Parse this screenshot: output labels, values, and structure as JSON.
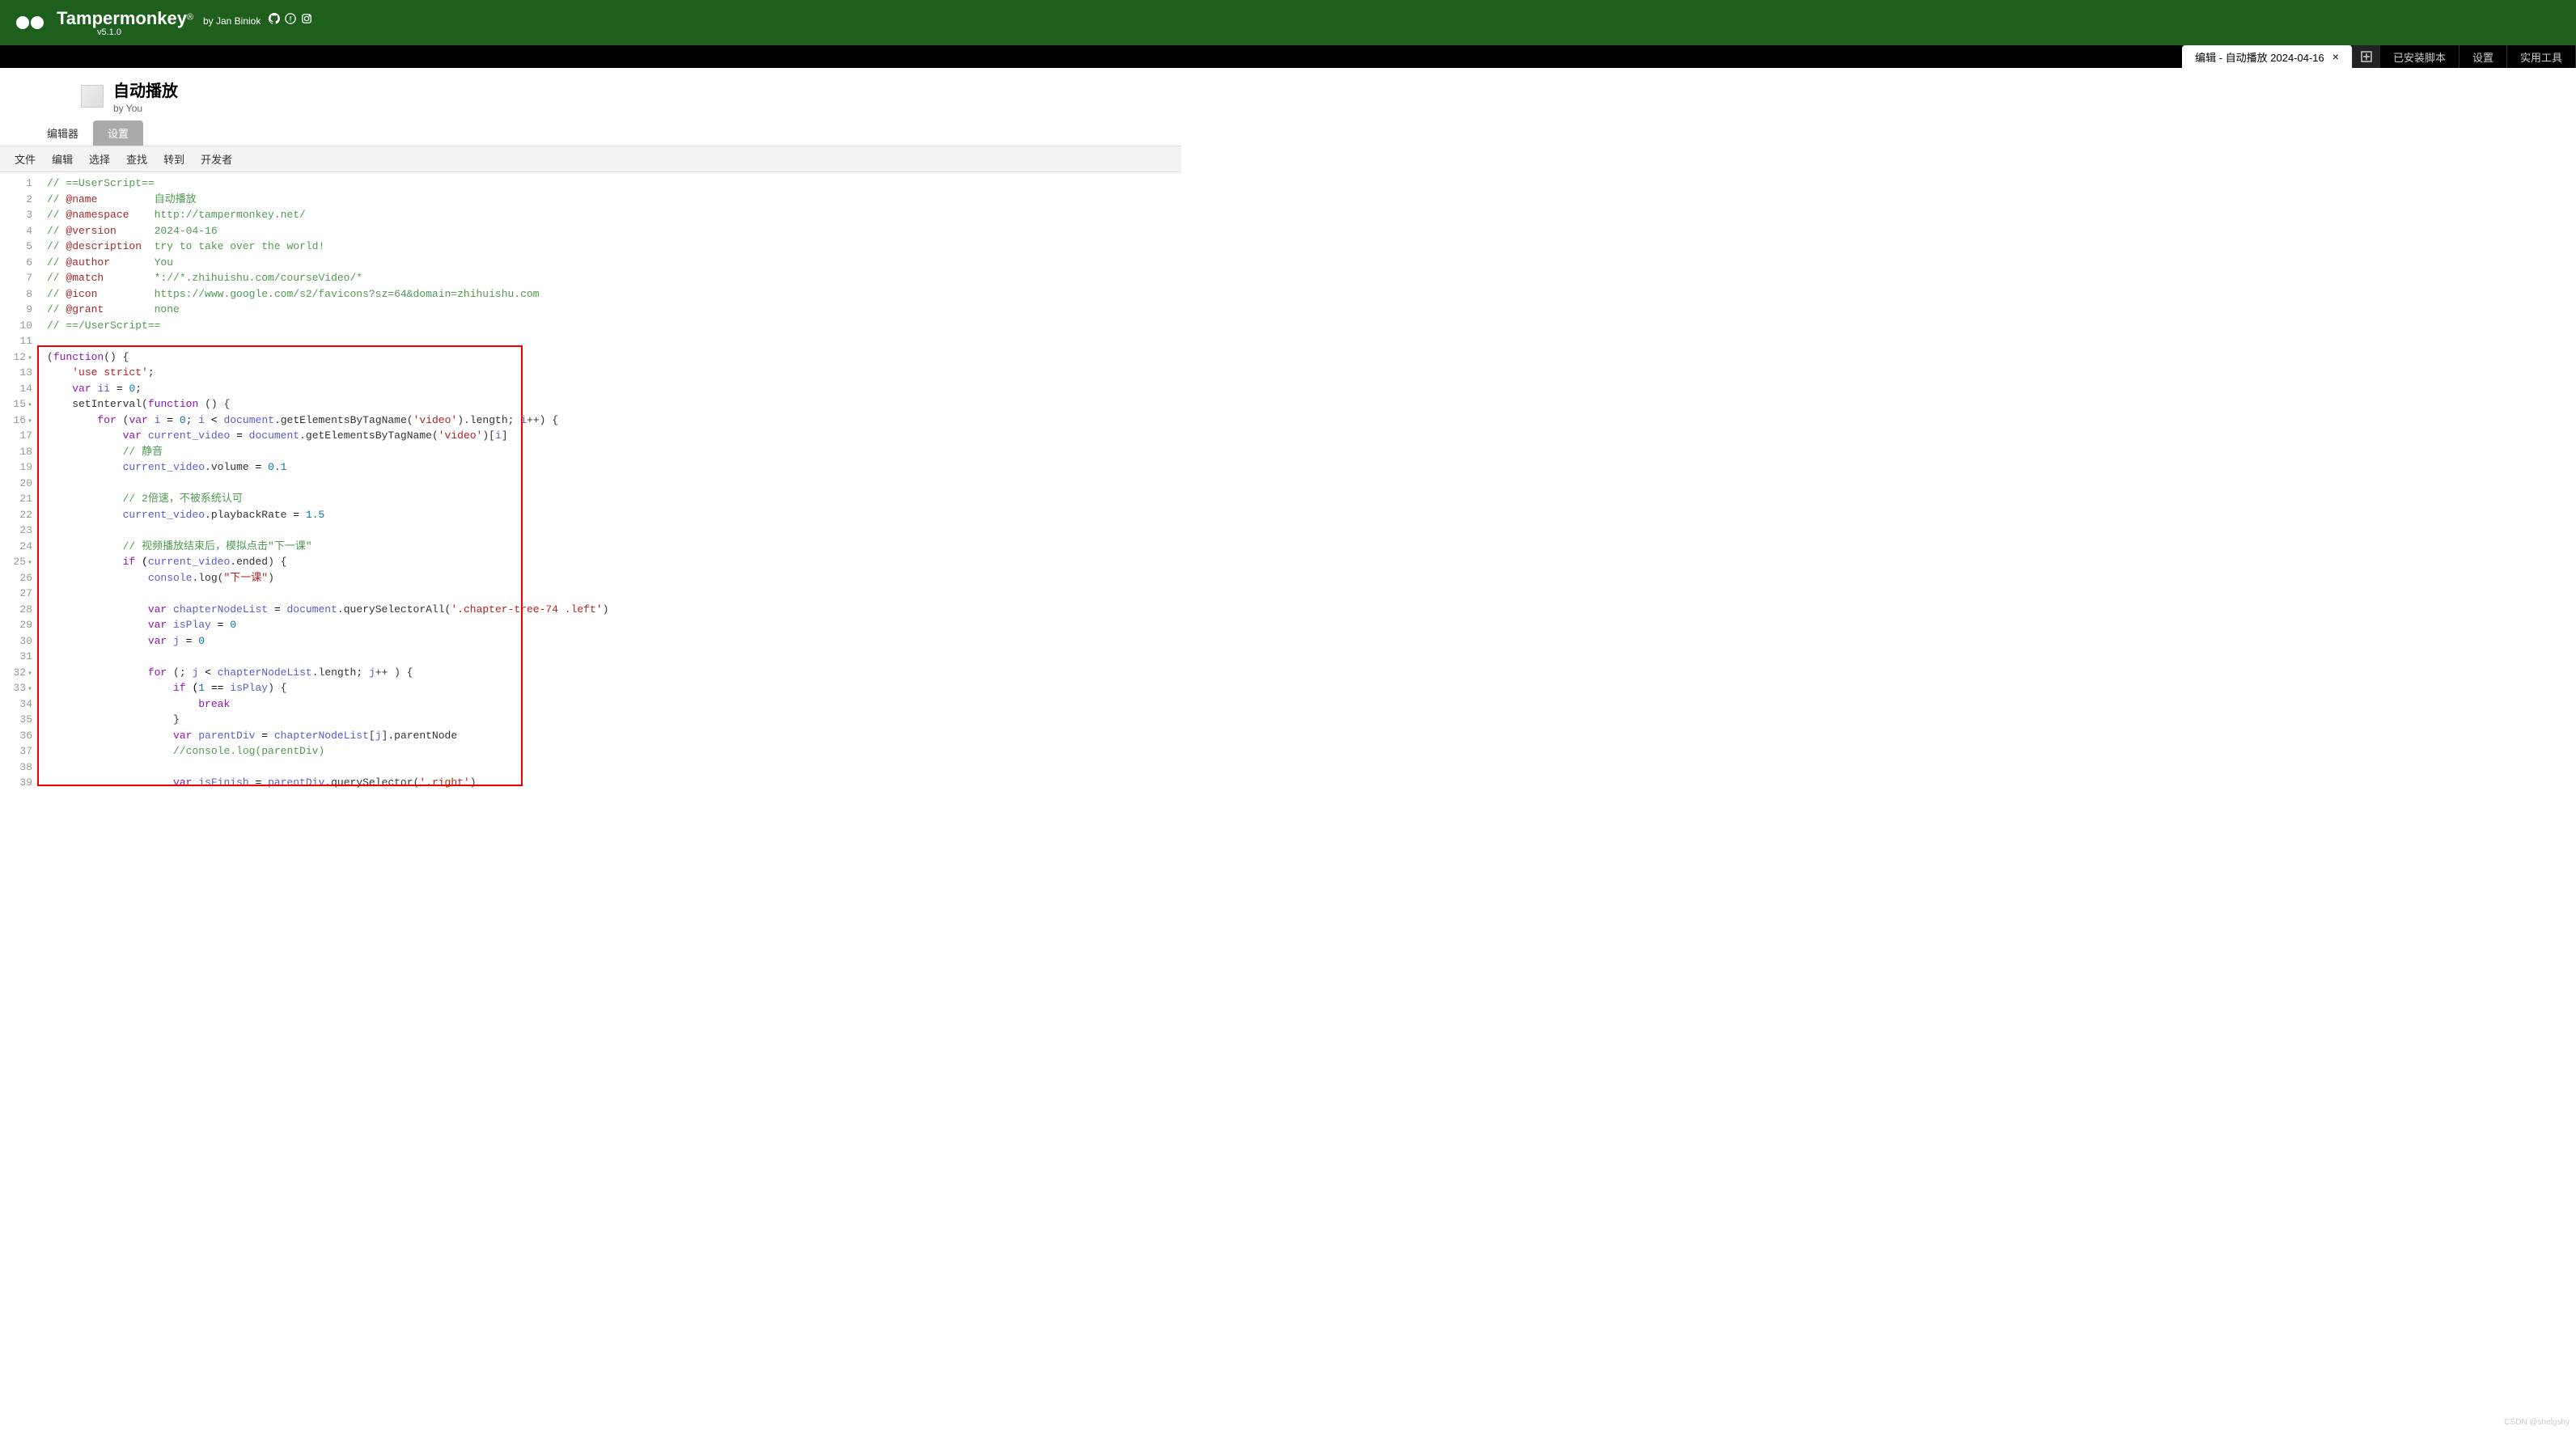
{
  "header": {
    "brand": "Tampermonkey",
    "reg": "®",
    "by": "by Jan Biniok",
    "version": "v5.1.0"
  },
  "tabs": {
    "active": "编辑 - 自动播放 2024-04-16",
    "installed": "已安装脚本",
    "settings": "设置",
    "utilities": "实用工具"
  },
  "script": {
    "title": "自动播放",
    "author": "by You"
  },
  "subtabs": {
    "editor": "编辑器",
    "settings": "设置"
  },
  "menu": {
    "file": "文件",
    "edit": "编辑",
    "select": "选择",
    "find": "查找",
    "goto": "转到",
    "dev": "开发者"
  },
  "code": {
    "lines": [
      {
        "n": "1",
        "t": [
          {
            "c": "c-comment",
            "v": "// ==UserScript=="
          }
        ]
      },
      {
        "n": "2",
        "t": [
          {
            "c": "c-comment",
            "v": "// "
          },
          {
            "c": "c-key",
            "v": "@name"
          },
          {
            "c": "c-comment",
            "v": "         自动播放"
          }
        ]
      },
      {
        "n": "3",
        "t": [
          {
            "c": "c-comment",
            "v": "// "
          },
          {
            "c": "c-key",
            "v": "@namespace"
          },
          {
            "c": "c-comment",
            "v": "    http://tampermonkey.net/"
          }
        ]
      },
      {
        "n": "4",
        "t": [
          {
            "c": "c-comment",
            "v": "// "
          },
          {
            "c": "c-key",
            "v": "@version"
          },
          {
            "c": "c-comment",
            "v": "      2024-04-16"
          }
        ]
      },
      {
        "n": "5",
        "t": [
          {
            "c": "c-comment",
            "v": "// "
          },
          {
            "c": "c-key",
            "v": "@description"
          },
          {
            "c": "c-comment",
            "v": "  try to take over the world!"
          }
        ]
      },
      {
        "n": "6",
        "t": [
          {
            "c": "c-comment",
            "v": "// "
          },
          {
            "c": "c-key",
            "v": "@author"
          },
          {
            "c": "c-comment",
            "v": "       You"
          }
        ]
      },
      {
        "n": "7",
        "t": [
          {
            "c": "c-comment",
            "v": "// "
          },
          {
            "c": "c-key",
            "v": "@match"
          },
          {
            "c": "c-comment",
            "v": "        *://*.zhihuishu.com/courseVideo/*"
          }
        ]
      },
      {
        "n": "8",
        "t": [
          {
            "c": "c-comment",
            "v": "// "
          },
          {
            "c": "c-key",
            "v": "@icon"
          },
          {
            "c": "c-comment",
            "v": "         https://www.google.com/s2/favicons?sz=64&domain=zhihuishu.com"
          }
        ]
      },
      {
        "n": "9",
        "t": [
          {
            "c": "c-comment",
            "v": "// "
          },
          {
            "c": "c-key",
            "v": "@grant"
          },
          {
            "c": "c-comment",
            "v": "        none"
          }
        ]
      },
      {
        "n": "10",
        "t": [
          {
            "c": "c-comment",
            "v": "// ==/UserScript=="
          }
        ]
      },
      {
        "n": "11",
        "t": []
      },
      {
        "n": "12",
        "f": true,
        "t": [
          {
            "c": "c-op",
            "v": "("
          },
          {
            "c": "c-keyword",
            "v": "function"
          },
          {
            "c": "c-op",
            "v": "() {"
          }
        ]
      },
      {
        "n": "13",
        "t": [
          {
            "c": "",
            "v": "    "
          },
          {
            "c": "c-string",
            "v": "'use strict'"
          },
          {
            "c": "c-op",
            "v": ";"
          }
        ]
      },
      {
        "n": "14",
        "t": [
          {
            "c": "",
            "v": "    "
          },
          {
            "c": "c-keyword",
            "v": "var"
          },
          {
            "c": "",
            "v": " "
          },
          {
            "c": "c-var",
            "v": "ii"
          },
          {
            "c": "",
            "v": " = "
          },
          {
            "c": "c-num",
            "v": "0"
          },
          {
            "c": "c-op",
            "v": ";"
          }
        ]
      },
      {
        "n": "15",
        "f": true,
        "t": [
          {
            "c": "",
            "v": "    "
          },
          {
            "c": "c-func",
            "v": "setInterval"
          },
          {
            "c": "c-op",
            "v": "("
          },
          {
            "c": "c-keyword",
            "v": "function"
          },
          {
            "c": "c-op",
            "v": " () {"
          }
        ]
      },
      {
        "n": "16",
        "f": true,
        "t": [
          {
            "c": "",
            "v": "        "
          },
          {
            "c": "c-keyword",
            "v": "for"
          },
          {
            "c": "c-op",
            "v": " ("
          },
          {
            "c": "c-keyword",
            "v": "var"
          },
          {
            "c": "",
            "v": " "
          },
          {
            "c": "c-var",
            "v": "i"
          },
          {
            "c": "",
            "v": " = "
          },
          {
            "c": "c-num",
            "v": "0"
          },
          {
            "c": "c-op",
            "v": "; "
          },
          {
            "c": "c-var",
            "v": "i"
          },
          {
            "c": "",
            "v": " < "
          },
          {
            "c": "c-var",
            "v": "document"
          },
          {
            "c": "c-op",
            "v": "."
          },
          {
            "c": "c-func",
            "v": "getElementsByTagName"
          },
          {
            "c": "c-op",
            "v": "("
          },
          {
            "c": "c-string",
            "v": "'video'"
          },
          {
            "c": "c-op",
            "v": ")."
          },
          {
            "c": "c-prop",
            "v": "length"
          },
          {
            "c": "c-op",
            "v": "; "
          },
          {
            "c": "c-var",
            "v": "i"
          },
          {
            "c": "c-op",
            "v": "++) {"
          }
        ]
      },
      {
        "n": "17",
        "t": [
          {
            "c": "",
            "v": "            "
          },
          {
            "c": "c-keyword",
            "v": "var"
          },
          {
            "c": "",
            "v": " "
          },
          {
            "c": "c-var",
            "v": "current_video"
          },
          {
            "c": "",
            "v": " = "
          },
          {
            "c": "c-var",
            "v": "document"
          },
          {
            "c": "c-op",
            "v": "."
          },
          {
            "c": "c-func",
            "v": "getElementsByTagName"
          },
          {
            "c": "c-op",
            "v": "("
          },
          {
            "c": "c-string",
            "v": "'video'"
          },
          {
            "c": "c-op",
            "v": ")["
          },
          {
            "c": "c-var",
            "v": "i"
          },
          {
            "c": "c-op",
            "v": "]"
          }
        ]
      },
      {
        "n": "18",
        "t": [
          {
            "c": "",
            "v": "            "
          },
          {
            "c": "c-comment",
            "v": "// 静音"
          }
        ]
      },
      {
        "n": "19",
        "t": [
          {
            "c": "",
            "v": "            "
          },
          {
            "c": "c-var",
            "v": "current_video"
          },
          {
            "c": "c-op",
            "v": "."
          },
          {
            "c": "c-prop",
            "v": "volume"
          },
          {
            "c": "",
            "v": " = "
          },
          {
            "c": "c-num",
            "v": "0.1"
          }
        ]
      },
      {
        "n": "20",
        "t": []
      },
      {
        "n": "21",
        "t": [
          {
            "c": "",
            "v": "            "
          },
          {
            "c": "c-comment",
            "v": "// 2倍速，不被系统认可"
          }
        ]
      },
      {
        "n": "22",
        "t": [
          {
            "c": "",
            "v": "            "
          },
          {
            "c": "c-var",
            "v": "current_video"
          },
          {
            "c": "c-op",
            "v": "."
          },
          {
            "c": "c-prop",
            "v": "playbackRate"
          },
          {
            "c": "",
            "v": " = "
          },
          {
            "c": "c-num",
            "v": "1.5"
          }
        ]
      },
      {
        "n": "23",
        "t": []
      },
      {
        "n": "24",
        "t": [
          {
            "c": "",
            "v": "            "
          },
          {
            "c": "c-comment",
            "v": "// 视频播放结束后，模拟点击\"下一课\""
          }
        ]
      },
      {
        "n": "25",
        "f": true,
        "t": [
          {
            "c": "",
            "v": "            "
          },
          {
            "c": "c-keyword",
            "v": "if"
          },
          {
            "c": "",
            "v": " ("
          },
          {
            "c": "c-var",
            "v": "current_video"
          },
          {
            "c": "c-op",
            "v": "."
          },
          {
            "c": "c-prop",
            "v": "ended"
          },
          {
            "c": "c-op",
            "v": ") {"
          }
        ]
      },
      {
        "n": "26",
        "t": [
          {
            "c": "",
            "v": "                "
          },
          {
            "c": "c-var",
            "v": "console"
          },
          {
            "c": "c-op",
            "v": "."
          },
          {
            "c": "c-func",
            "v": "log"
          },
          {
            "c": "c-op",
            "v": "("
          },
          {
            "c": "c-string",
            "v": "\"下一课\""
          },
          {
            "c": "c-op",
            "v": ")"
          }
        ]
      },
      {
        "n": "27",
        "t": []
      },
      {
        "n": "28",
        "t": [
          {
            "c": "",
            "v": "                "
          },
          {
            "c": "c-keyword",
            "v": "var"
          },
          {
            "c": "",
            "v": " "
          },
          {
            "c": "c-var",
            "v": "chapterNodeList"
          },
          {
            "c": "",
            "v": " = "
          },
          {
            "c": "c-var",
            "v": "document"
          },
          {
            "c": "c-op",
            "v": "."
          },
          {
            "c": "c-func",
            "v": "querySelectorAll"
          },
          {
            "c": "c-op",
            "v": "("
          },
          {
            "c": "c-string",
            "v": "'.chapter-tree-74 .left'"
          },
          {
            "c": "c-op",
            "v": ")"
          }
        ]
      },
      {
        "n": "29",
        "t": [
          {
            "c": "",
            "v": "                "
          },
          {
            "c": "c-keyword",
            "v": "var"
          },
          {
            "c": "",
            "v": " "
          },
          {
            "c": "c-var",
            "v": "isPlay"
          },
          {
            "c": "",
            "v": " = "
          },
          {
            "c": "c-num",
            "v": "0"
          }
        ]
      },
      {
        "n": "30",
        "t": [
          {
            "c": "",
            "v": "                "
          },
          {
            "c": "c-keyword",
            "v": "var"
          },
          {
            "c": "",
            "v": " "
          },
          {
            "c": "c-var",
            "v": "j"
          },
          {
            "c": "",
            "v": " = "
          },
          {
            "c": "c-num",
            "v": "0"
          }
        ]
      },
      {
        "n": "31",
        "t": []
      },
      {
        "n": "32",
        "f": true,
        "t": [
          {
            "c": "",
            "v": "                "
          },
          {
            "c": "c-keyword",
            "v": "for"
          },
          {
            "c": "c-op",
            "v": " (; "
          },
          {
            "c": "c-var",
            "v": "j"
          },
          {
            "c": "",
            "v": " < "
          },
          {
            "c": "c-var",
            "v": "chapterNodeList"
          },
          {
            "c": "c-op",
            "v": "."
          },
          {
            "c": "c-prop",
            "v": "length"
          },
          {
            "c": "c-op",
            "v": "; "
          },
          {
            "c": "c-var",
            "v": "j"
          },
          {
            "c": "c-op",
            "v": "++ ) {"
          }
        ]
      },
      {
        "n": "33",
        "f": true,
        "t": [
          {
            "c": "",
            "v": "                    "
          },
          {
            "c": "c-keyword",
            "v": "if"
          },
          {
            "c": "",
            "v": " ("
          },
          {
            "c": "c-num",
            "v": "1"
          },
          {
            "c": "",
            "v": " == "
          },
          {
            "c": "c-var",
            "v": "isPlay"
          },
          {
            "c": "c-op",
            "v": ") {"
          }
        ]
      },
      {
        "n": "34",
        "t": [
          {
            "c": "",
            "v": "                        "
          },
          {
            "c": "c-keyword",
            "v": "break"
          }
        ]
      },
      {
        "n": "35",
        "t": [
          {
            "c": "",
            "v": "                    "
          },
          {
            "c": "c-op",
            "v": "}"
          }
        ]
      },
      {
        "n": "36",
        "t": [
          {
            "c": "",
            "v": "                    "
          },
          {
            "c": "c-keyword",
            "v": "var"
          },
          {
            "c": "",
            "v": " "
          },
          {
            "c": "c-var",
            "v": "parentDiv"
          },
          {
            "c": "",
            "v": " = "
          },
          {
            "c": "c-var",
            "v": "chapterNodeList"
          },
          {
            "c": "c-op",
            "v": "["
          },
          {
            "c": "c-var",
            "v": "j"
          },
          {
            "c": "c-op",
            "v": "]."
          },
          {
            "c": "c-prop",
            "v": "parentNode"
          }
        ]
      },
      {
        "n": "37",
        "t": [
          {
            "c": "",
            "v": "                    "
          },
          {
            "c": "c-comment",
            "v": "//console.log(parentDiv)"
          }
        ]
      },
      {
        "n": "38",
        "t": []
      },
      {
        "n": "39",
        "t": [
          {
            "c": "",
            "v": "                    "
          },
          {
            "c": "c-keyword",
            "v": "var"
          },
          {
            "c": "",
            "v": " "
          },
          {
            "c": "c-var",
            "v": "isFinish"
          },
          {
            "c": "",
            "v": " = "
          },
          {
            "c": "c-var",
            "v": "parentDiv"
          },
          {
            "c": "c-op",
            "v": "."
          },
          {
            "c": "c-func",
            "v": "querySelector"
          },
          {
            "c": "c-op",
            "v": "("
          },
          {
            "c": "c-string",
            "v": "'.right'"
          },
          {
            "c": "c-op",
            "v": ")"
          }
        ]
      }
    ]
  },
  "watermark": "CSDN @shelgshy"
}
